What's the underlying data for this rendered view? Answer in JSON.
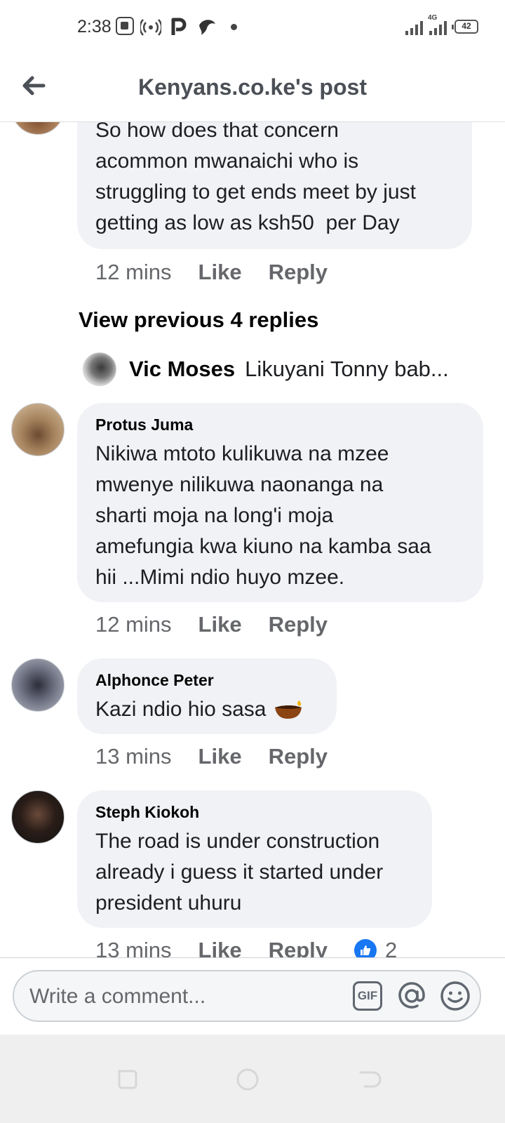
{
  "status_bar": {
    "time": "2:38",
    "network": "4G",
    "battery": "42"
  },
  "header": {
    "title": "Kenyans.co.ke's post"
  },
  "comments": [
    {
      "author": "",
      "text": "So how does that concern\nacommon mwanaichi who is\nstruggling to get ends meet by just\ngetting as low as ksh50  per Day",
      "time": "12 mins",
      "like": "Like",
      "reply": "Reply"
    },
    {
      "author": "Protus Juma",
      "text": "Nikiwa mtoto kulikuwa na mzee\nmwenye nilikuwa naonanga na\nsharti moja na long'i moja\namefungia kwa kiuno na kamba saa\nhii ...Mimi ndio huyo mzee.",
      "time": "12 mins",
      "like": "Like",
      "reply": "Reply"
    },
    {
      "author": "Alphonce Peter",
      "text": "Kazi ndio hio sasa",
      "time": "13 mins",
      "like": "Like",
      "reply": "Reply"
    },
    {
      "author": "Steph Kiokoh",
      "text": "The road is under construction\nalready i guess it started under\npresident uhuru",
      "time": "13 mins",
      "like": "Like",
      "reply": "Reply",
      "like_count": "2"
    }
  ],
  "view_previous": "View previous 4 replies",
  "reply_preview": {
    "author": "Vic Moses",
    "text": "Likuyani Tonny bab..."
  },
  "composer": {
    "placeholder": "Write a comment...",
    "gif_label": "GIF"
  },
  "colors": {
    "accent": "#1877f2",
    "bubble": "#f0f2f5",
    "meta_text": "#65676b"
  }
}
